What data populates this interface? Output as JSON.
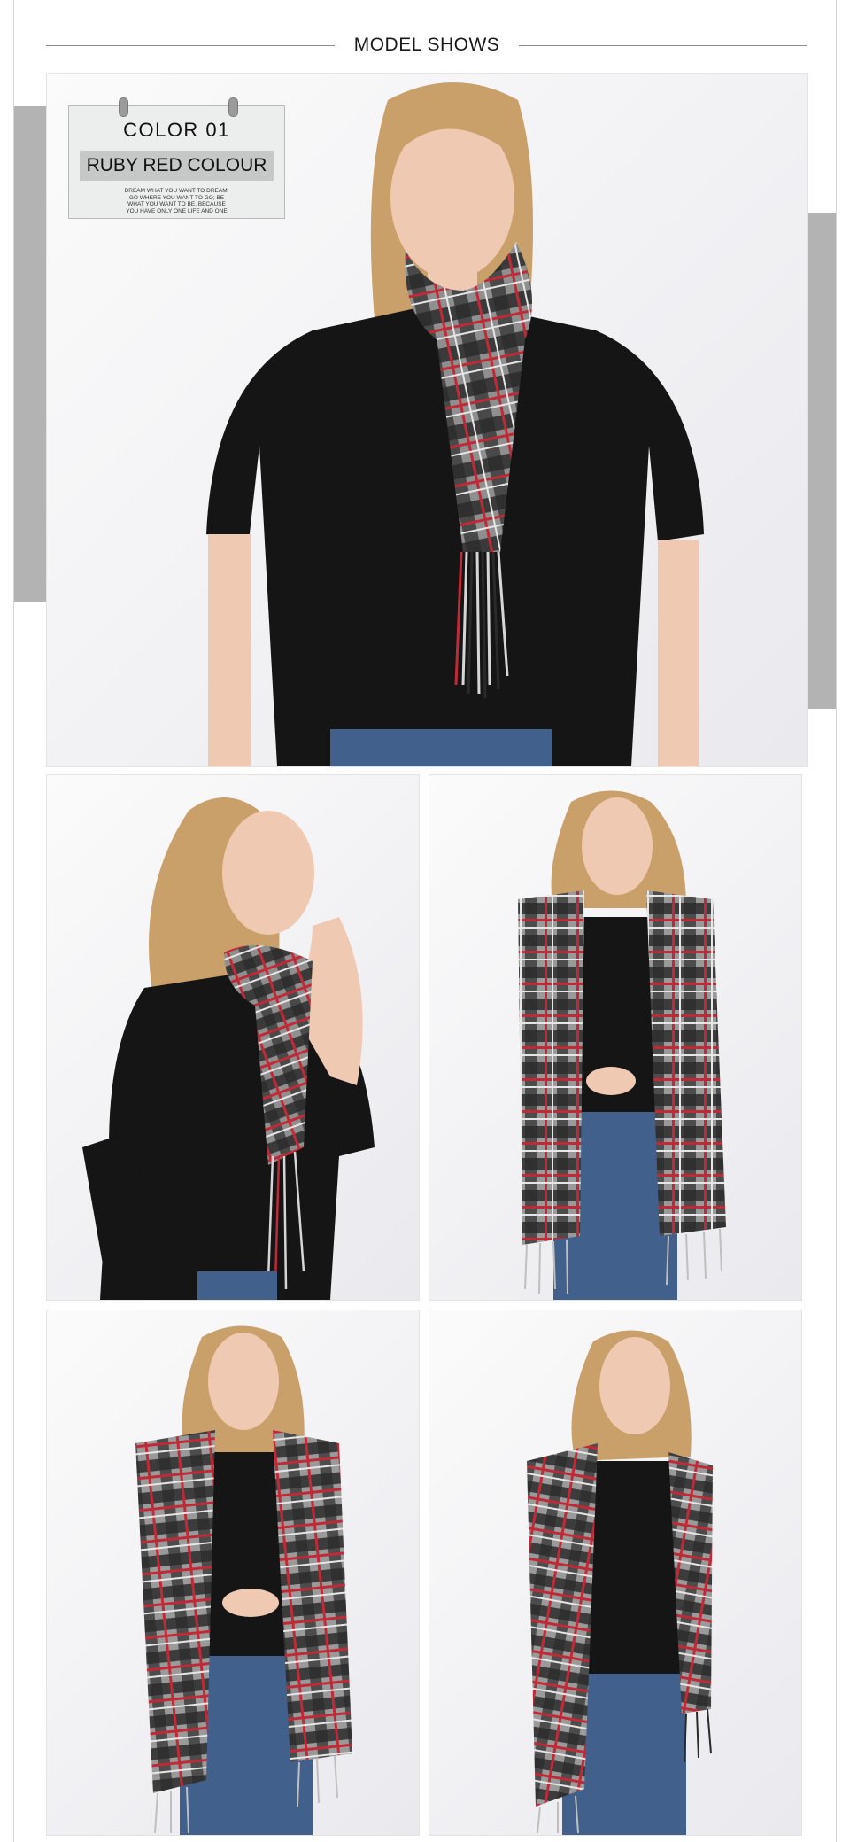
{
  "header": {
    "title": "MODEL SHOWS"
  },
  "tag": {
    "color_number": "COLOR 01",
    "color_name": "RUBY RED COLOUR",
    "tagline": [
      "DREAM WHAT YOU WANT TO DREAM;",
      "GO WHERE YOU WANT TO GO; BE",
      "WHAT YOU WANT TO BE, BECAUSE",
      "YOU HAVE ONLY ONE LIFE AND ONE"
    ]
  },
  "photos": [
    {
      "name": "model-photo-main",
      "pose": "front scarf knotted at neck"
    },
    {
      "name": "model-photo-side",
      "pose": "side profile hand at chin"
    },
    {
      "name": "model-photo-open",
      "pose": "scarf draped open holding fronts"
    },
    {
      "name": "model-photo-hands",
      "pose": "scarf draped hands crossed"
    },
    {
      "name": "model-photo-turned",
      "pose": "three quarter turned"
    }
  ],
  "colors": {
    "frame_line": "#d6d6d6",
    "deco_bar": "#b3b3b3",
    "tag_background": "#eceeed",
    "tag_band": "#c6c8c8",
    "scarf_dark": "#2a2a2a",
    "scarf_grey": "#9a9a9a",
    "scarf_red": "#c02a36",
    "shirt_black": "#151515",
    "denim": "#41618c",
    "hair": "#c9a06a",
    "skin": "#efc9b1"
  }
}
